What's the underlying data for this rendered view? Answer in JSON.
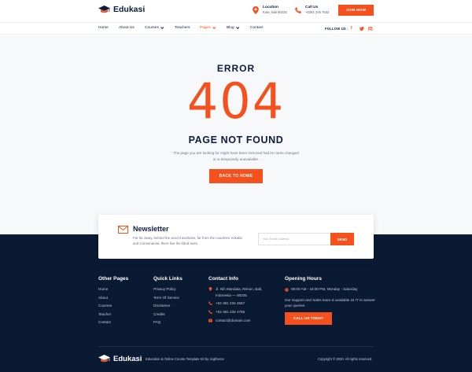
{
  "brand": {
    "name": "Edukasi",
    "accent": "#f4511e",
    "navy": "#0b1a33"
  },
  "header": {
    "location": {
      "title": "Location",
      "value": "Kuta, Bali 80225",
      "icon": "map-pin-icon"
    },
    "call": {
      "title": "Call Us",
      "value": "+6281 245 7632",
      "icon": "phone-icon"
    },
    "join_label": "JOIN NOW"
  },
  "nav": {
    "items": [
      {
        "label": "Home"
      },
      {
        "label": "About Us"
      },
      {
        "label": "Courses"
      },
      {
        "label": "Teachers"
      },
      {
        "label": "Pages"
      },
      {
        "label": "Blog"
      },
      {
        "label": "Contact"
      }
    ],
    "follow_label": "FOLLOW US :",
    "social": [
      "f",
      "t",
      "o"
    ]
  },
  "error_page": {
    "label": "ERROR",
    "code": "404",
    "title": "PAGE NOT FOUND",
    "description": "The page you are looking for might have been removed had its name changed or is temporarily unavailable.",
    "back_label": "BACK TO HOME"
  },
  "newsletter": {
    "title": "Newsletter",
    "description": "Far far away, behind the word mountains, far from the countries Vokalia and Consonantia, there live the blind texts.",
    "placeholder": "Your Email Address",
    "send_label": "SEND"
  },
  "footer": {
    "other_pages": {
      "title": "Other Pages",
      "items": [
        "Home",
        "About",
        "Courses",
        "Teacher",
        "Contact"
      ]
    },
    "quick_links": {
      "title": "Quick Links",
      "items": [
        "Privacy Policy",
        "Term Of Service",
        "Disclaimer",
        "Credits",
        "FAQ"
      ]
    },
    "contact": {
      "title": "Contact Info",
      "address_line1": "Jl. Nih Mandala, Renon, Bali,",
      "address_line2": "Indonesia — 80225",
      "phone1": "+62 361 234 4567",
      "phone2": "+62 361 234 4765",
      "email": "contact@domain.com"
    },
    "hours": {
      "title": "Opening Hours",
      "time": "08:00 AM - 15:00 PM, Monday - Saturday",
      "support": "Our Support and Sales team is available 24 /7 to answer your queries",
      "call_label": "CALL US TODAY"
    },
    "tagline": "Education & Online Course Template Kit by Jegtheme",
    "copyright": "Copyright © 2020. All rights reserved."
  }
}
